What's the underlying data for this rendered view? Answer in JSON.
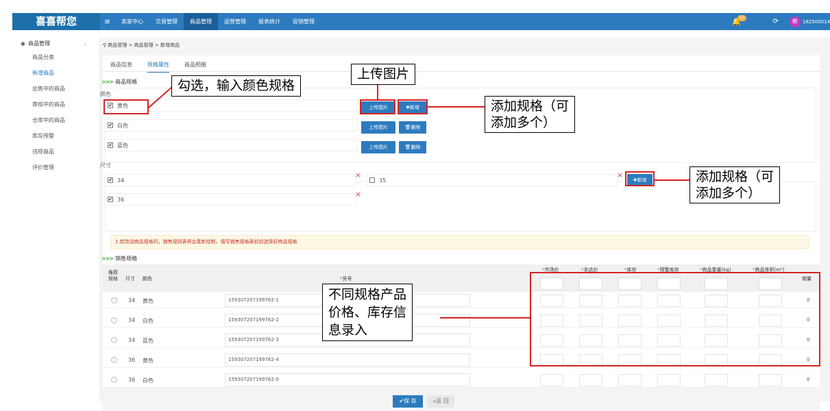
{
  "brand": "喜喜帮您",
  "nav": {
    "items": [
      "卖家中心",
      "交易管理",
      "商品管理",
      "运营管理",
      "报表统计",
      "促销管理"
    ],
    "active_index": 2,
    "badge": "10",
    "avatar_char": "帮",
    "username": "182500014"
  },
  "sidebar": {
    "head": "商品管理",
    "items": [
      "商品分类",
      "新增商品",
      "出售中的商品",
      "审核中的商品",
      "仓库中的商品",
      "库存预警",
      "违规商品",
      "评价管理"
    ],
    "active_index": 1
  },
  "breadcrumb": "商品管理 > 商品管理 > 新增商品",
  "tabs": [
    "商品信息",
    "规格属性",
    "商品相册"
  ],
  "active_tab": 1,
  "spec_section": {
    "title": "商品规格",
    "color_label": "颜色",
    "colors": [
      "黄色",
      "白色",
      "蓝色"
    ],
    "upload_label": "上传图片",
    "add_label": "✚新增",
    "delete_label": "🗑删除",
    "size_label": "尺寸",
    "sizes": [
      {
        "value": "34",
        "checked": true
      },
      {
        "value": "35",
        "checked": false
      },
      {
        "value": "36",
        "checked": true
      }
    ]
  },
  "notice": "1.若改动商品规格时，销售规则表将会重新绘制，填写销售规格表前前选择好商品规格",
  "sales_section": {
    "title": "销售规格",
    "headers": {
      "recommend": "推荐规格",
      "size": "尺寸",
      "color": "颜色",
      "sku": "货号",
      "market_price": "市场价",
      "store_price": "本店价",
      "stock": "库存",
      "warn_stock": "预警库存",
      "weight": "商品重量(kg)",
      "volume": "商品体积(m³)",
      "sales": "销量"
    },
    "rows": [
      {
        "size": "34",
        "color": "黄色",
        "sku": "159307207199762-1",
        "sales": "0"
      },
      {
        "size": "34",
        "color": "白色",
        "sku": "159307207199762-2",
        "sales": "0"
      },
      {
        "size": "34",
        "color": "蓝色",
        "sku": "159307207199762-3",
        "sales": "0"
      },
      {
        "size": "36",
        "color": "黄色",
        "sku": "159307207199762-4",
        "sales": "0"
      },
      {
        "size": "36",
        "color": "白色",
        "sku": "159307207199762-5",
        "sales": "0"
      }
    ]
  },
  "footer": {
    "save": "✔保 存",
    "back": "«返 回"
  },
  "annotations": {
    "check_colors": "勾选，输入颜色规格",
    "upload": "上传图片",
    "add_spec_1": "添加规格（可\n添加多个）",
    "add_spec_2": "添加规格（可\n添加多个）",
    "price_entry": "不同规格产品\n价格、库存信\n息录入"
  },
  "colors": {
    "nav": "#2d7bbf",
    "brand": "#1c6fa9",
    "annotation": "#d62222"
  }
}
